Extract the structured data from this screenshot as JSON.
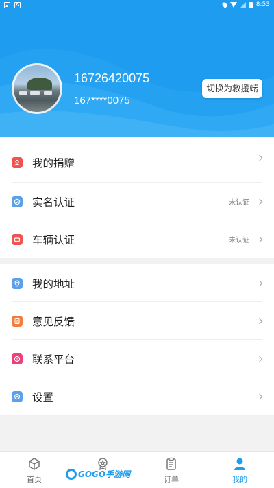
{
  "status_bar": {
    "time": "8:53",
    "left_icons": [
      "image-icon",
      "a-icon"
    ],
    "right_icons": [
      "location-icon",
      "wifi-icon",
      "signal-icon",
      "battery-icon"
    ]
  },
  "profile": {
    "phone": "16726420075",
    "phone_masked": "167****0075",
    "switch_button": "切换为救援端"
  },
  "menu_group1": [
    {
      "label": "我的捐赠",
      "status": "",
      "icon": "donation-icon",
      "color": "#ef5350"
    },
    {
      "label": "实名认证",
      "status": "未认证",
      "icon": "verify-icon",
      "color": "#5aa0ea"
    },
    {
      "label": "车辆认证",
      "status": "未认证",
      "icon": "car-icon",
      "color": "#ef5350"
    }
  ],
  "menu_group2": [
    {
      "label": "我的地址",
      "icon": "location-pin-icon",
      "color": "#5aa0ea"
    },
    {
      "label": "意见反馈",
      "icon": "feedback-icon",
      "color": "#f57c3a"
    },
    {
      "label": "联系平台",
      "icon": "contact-icon",
      "color": "#ec407a"
    },
    {
      "label": "设置",
      "icon": "settings-icon",
      "color": "#5aa0ea"
    }
  ],
  "bottom_nav": [
    {
      "label": "首页",
      "icon": "home-icon",
      "active": false
    },
    {
      "label": "",
      "icon": "medal-icon",
      "active": false
    },
    {
      "label": "订单",
      "icon": "order-icon",
      "active": false
    },
    {
      "label": "我的",
      "icon": "profile-icon",
      "active": true
    }
  ],
  "watermark": "GOGO手游网",
  "colors": {
    "primary": "#1e9cf0",
    "background": "#f2f2f2"
  }
}
